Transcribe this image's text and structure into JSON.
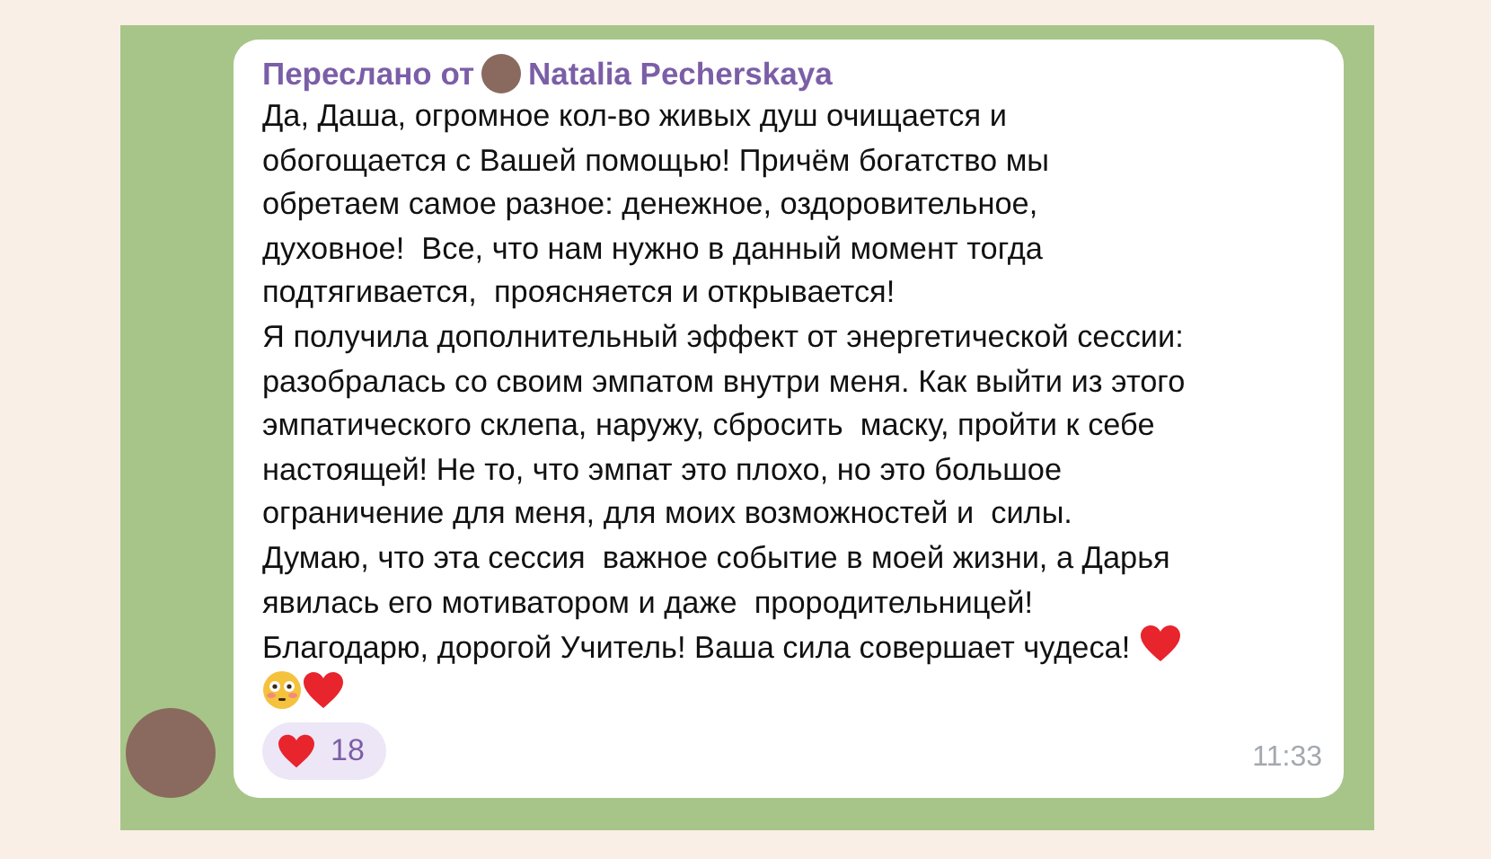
{
  "message": {
    "forwarded_label": "Переслано от",
    "forwarded_from": "Natalia Pecherskaya",
    "lines": [
      "Да, Даша, огромное кол-во живых душ очищается и",
      "обогощается с Вашей помощью! Причём богатство мы",
      "обретаем самое разное: денежное, оздоровительное,",
      "духовное!  Все, что нам нужно в данный момент тогда",
      "подтягивается,  проясняется и открывается!",
      "Я получила дополнительный эффект от энергетической сессии:",
      "разобралась со своим эмпатом внутри меня. Как выйти из этого",
      "эмпатического склепа, наружу, сбросить  маску, пройти к себе",
      "настоящей! Не то, что эмпат это плохо, но это большое",
      "ограничение для меня, для моих возможностей и  силы.",
      "Думаю, что эта сессия  важное событие в моей жизни, а Дарья",
      "явилась его мотиватором и даже  прородительницей!",
      "Благодарю, дорогой Учитель! Ваша сила совершает чудеса!"
    ],
    "reaction": {
      "count": "18"
    },
    "time": "11:33"
  }
}
